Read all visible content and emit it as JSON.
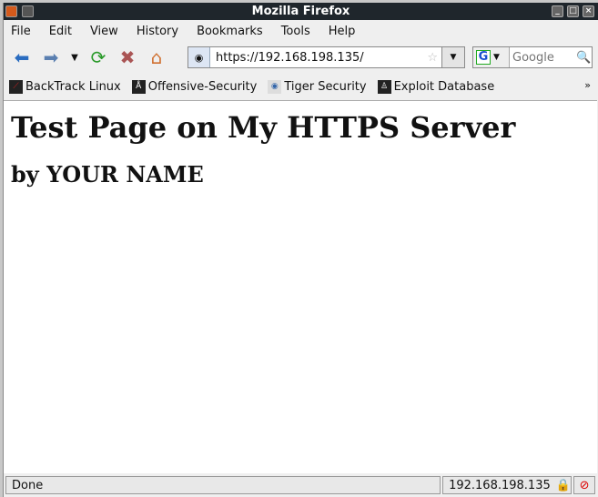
{
  "window": {
    "title": "Mozilla Firefox"
  },
  "menu": [
    "File",
    "Edit",
    "View",
    "History",
    "Bookmarks",
    "Tools",
    "Help"
  ],
  "nav": {
    "url": "https://192.168.198.135/",
    "search_placeholder": "Google",
    "search_engine": "G"
  },
  "bookmarks": [
    "BackTrack Linux",
    "Offensive-Security",
    "Tiger Security",
    "Exploit Database"
  ],
  "bookmarks_overflow": "»",
  "page": {
    "heading": "Test Page on My HTTPS Server",
    "subheading": "by YOUR NAME"
  },
  "status": {
    "text": "Done",
    "host": "192.168.198.135"
  }
}
